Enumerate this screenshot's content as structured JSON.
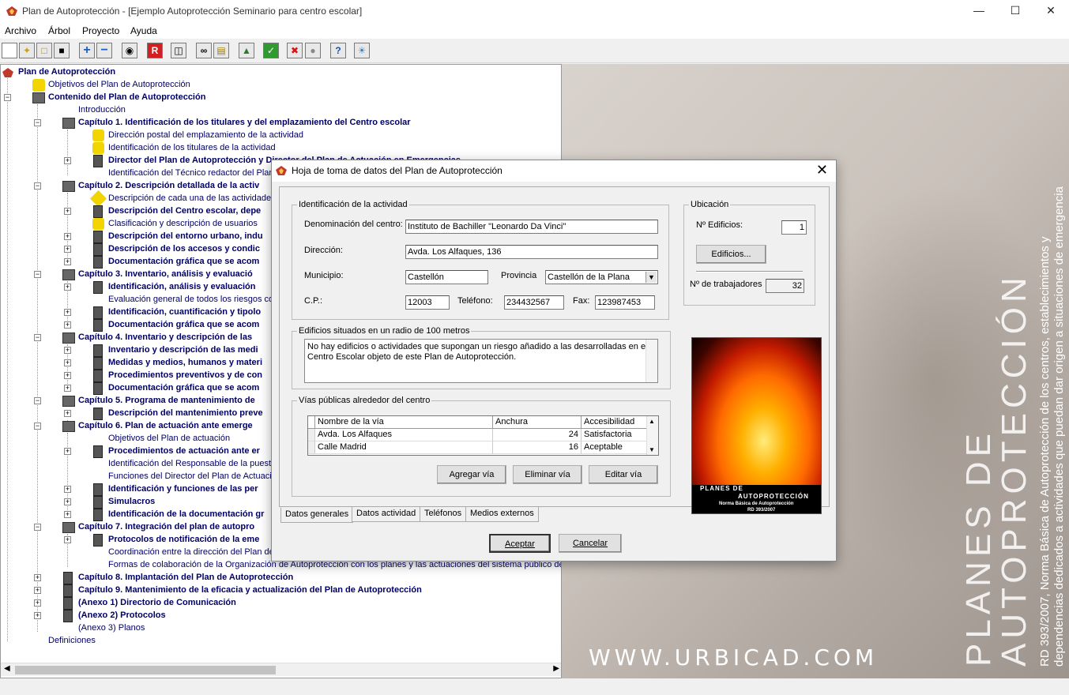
{
  "window": {
    "title": "Plan de Autoprotección - [Ejemplo Autoprotección Seminario para centro escolar]"
  },
  "menu": [
    "Archivo",
    "Árbol",
    "Proyecto",
    "Ayuda"
  ],
  "tree": [
    {
      "label": "Plan de Autoprotección"
    },
    {
      "label": "Objetivos del Plan de Autoprotección"
    },
    {
      "label": "Contenido del Plan de Autoprotección"
    },
    {
      "label": "Introducción"
    },
    {
      "label": "Capítulo 1. Identificación de los titulares y del emplazamiento del Centro escolar"
    },
    {
      "label": "Dirección postal del emplazamiento de la actividad"
    },
    {
      "label": "Identificación de los titulares de la actividad"
    },
    {
      "label": "Director del Plan de Autoprotección y Director del Plan de Actuación en Emergencias"
    },
    {
      "label": "Identificación del Técnico redactor del Plan"
    },
    {
      "label": "Capítulo 2. Descripción detallada de la activ"
    },
    {
      "label": "Descripción de cada una de las actividades"
    },
    {
      "label": "Descripción del Centro escolar, depe"
    },
    {
      "label": "Clasificación y descripción de usuarios"
    },
    {
      "label": "Descripción del entorno urbano, indu"
    },
    {
      "label": "Descripción de los accesos y condic"
    },
    {
      "label": "Documentación gráfica que se acom"
    },
    {
      "label": "Capítulo 3. Inventario, análisis y evaluació"
    },
    {
      "label": "Identificación, análisis y evaluación"
    },
    {
      "label": "Evaluación general de todos los riesgos con"
    },
    {
      "label": "Identificación, cuantificación y tipolo"
    },
    {
      "label": "Documentación gráfica que se acom"
    },
    {
      "label": "Capítulo 4. Inventario y descripción de las"
    },
    {
      "label": "Inventario y descripción de las medi"
    },
    {
      "label": "Medidas y medios, humanos y materi"
    },
    {
      "label": "Procedimientos preventivos y de con"
    },
    {
      "label": "Documentación gráfica que se acom"
    },
    {
      "label": "Capítulo 5. Programa de mantenimiento de"
    },
    {
      "label": "Descripción del mantenimiento preve"
    },
    {
      "label": "Capítulo 6. Plan de actuación ante emerge"
    },
    {
      "label": "Objetivos del Plan de actuación"
    },
    {
      "label": "Procedimientos de actuación ante er"
    },
    {
      "label": "Identificación del Responsable de la puesta"
    },
    {
      "label": "Funciones del Director del Plan de Actuació"
    },
    {
      "label": "Identificación y funciones de las per"
    },
    {
      "label": "Simulacros"
    },
    {
      "label": "Identificación de la documentación gr"
    },
    {
      "label": "Capítulo 7. Integración del plan de autopro"
    },
    {
      "label": "Protocolos de notificación de la eme"
    },
    {
      "label": "Coordinación entre la dirección del Plan de A"
    },
    {
      "label": "Formas de colaboración de la Organización de Autoprotección con los planes y las actuaciones del sistema público de Pro"
    },
    {
      "label": "Capítulo 8. Implantación del Plan de Autoprotección"
    },
    {
      "label": "Capítulo 9. Mantenimiento de la eficacia y actualización del Plan de Autoprotección"
    },
    {
      "label": "(Anexo 1) Directorio de Comunicación"
    },
    {
      "label": "(Anexo 2) Protocolos"
    },
    {
      "label": "(Anexo 3) Planos"
    },
    {
      "label": "Definiciones"
    }
  ],
  "background": {
    "url": "WWW.URBICAD.COM",
    "big1": "PLANES DE",
    "big2": "AUTOPROTECCIÓN",
    "small1": "RD 393/2007, Norma Básica de Autoprotección de los centros, establecimientos y",
    "small2": "dependencias dedicados a actividades que puedan dar origen a situaciones de emergencia"
  },
  "dialog": {
    "title": "Hoja de toma de datos del Plan de Autoprotección",
    "identificacion": {
      "legend": "Identificación de la actividad",
      "denominacion_label": "Denominación del centro:",
      "denominacion": "Instituto de Bachiller \"Leonardo Da Vinci\"",
      "direccion_label": "Dirección:",
      "direccion": "Avda. Los Alfaques, 136",
      "municipio_label": "Municipio:",
      "municipio": "Castellón",
      "provincia_label": "Provincia",
      "provincia": "Castellón de la Plana",
      "cp_label": "C.P.:",
      "cp": "12003",
      "telefono_label": "Teléfono:",
      "telefono": "234432567",
      "fax_label": "Fax:",
      "fax": "123987453"
    },
    "ubicacion": {
      "legend": "Ubicación",
      "edificios_label": "Nº Edificios:",
      "edificios": "1",
      "edificios_button": "Edificios...",
      "trabajadores_label": "Nº de trabajadores",
      "trabajadores": "32"
    },
    "radio": {
      "legend": "Edificios situados en un radio de 100 metros",
      "text": "No hay edificios o actividades que supongan un riesgo añadido a las desarrolladas en el Centro Escolar objeto de este Plan de Autoprotección."
    },
    "vias": {
      "legend": "Vías públicas alrededor del centro",
      "columns": [
        "Nombre de la vía",
        "Anchura",
        "Accesibilidad"
      ],
      "rows": [
        [
          "Avda. Los Alfaques",
          "24",
          "Satisfactoria"
        ],
        [
          "Calle Madrid",
          "16",
          "Aceptable"
        ]
      ],
      "add": "Agregar vía",
      "remove": "Eliminar vía",
      "edit": "Editar vía"
    },
    "promo": {
      "line1": "PLANES DE",
      "line2": "AUTOPROTECCIÓN",
      "line3": "Norma Básica de Autoprotección",
      "line4": "RD 393/2007"
    },
    "tabs": [
      "Datos generales",
      "Datos actividad",
      "Teléfonos",
      "Medios externos"
    ],
    "accept": "Aceptar",
    "cancel": "Cancelar"
  }
}
